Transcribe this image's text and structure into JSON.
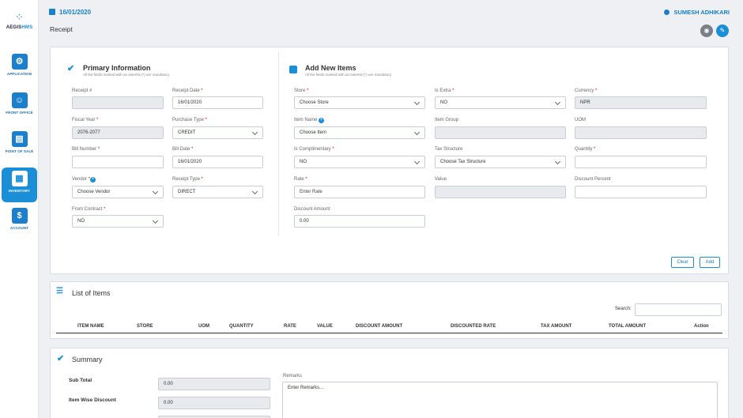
{
  "app": {
    "logo_text_a": "AEGIS",
    "logo_text_b": "HMS"
  },
  "sidebar": {
    "items": [
      {
        "label": "APPLICATION",
        "icon": "gear-monitor-icon"
      },
      {
        "label": "FRONT OFFICE",
        "icon": "reception-icon"
      },
      {
        "label": "POINT OF SALE",
        "icon": "pos-icon"
      },
      {
        "label": "INVENTORY",
        "icon": "inventory-icon",
        "active": true
      },
      {
        "label": "ACCOUNT",
        "icon": "dollar-icon"
      }
    ]
  },
  "header": {
    "date": "16/01/2020",
    "user": "SUMESH ADHIKARI",
    "page_title": "Receipt"
  },
  "primary": {
    "title": "Primary Information",
    "subtitle": "All the fields marked with an asterisk (*) are mandatory.",
    "receipt_no_label": "Receipt #",
    "receipt_no": "",
    "receipt_date_label": "Receipt Date",
    "receipt_date": "16/01/2020",
    "fiscal_year_label": "Fiscal Year",
    "fiscal_year": "2076-2077",
    "purchase_type_label": "Purchase Type",
    "purchase_type": "CREDIT",
    "bill_number_label": "Bill Number",
    "bill_number": "",
    "bill_date_label": "Bill Date",
    "bill_date": "16/01/2020",
    "vendor_label": "Vendor",
    "vendor": "Choose Vendor",
    "receipt_type_label": "Receipt Type",
    "receipt_type": "DIRECT",
    "from_contract_label": "From Contract",
    "from_contract": "NO"
  },
  "new_items": {
    "title": "Add New Items",
    "subtitle": "All the fields marked with an asterisk (*) are mandatory.",
    "store_label": "Store",
    "store": "Choose Store",
    "is_extra_label": "Is Extra",
    "is_extra": "NO",
    "currency_label": "Currency",
    "currency": "NPR",
    "item_name_label": "Item Name",
    "item_name": "Choose Item",
    "item_group_label": "Item Group",
    "item_group": "",
    "uom_label": "UOM",
    "uom": "",
    "is_complimentary_label": "Is Complimentary",
    "is_complimentary": "NO",
    "tax_structure_label": "Tax Structure",
    "tax_structure": "Choose Tax Structure",
    "quantity_label": "Quantity",
    "quantity": "",
    "rate_label": "Rate",
    "rate_placeholder": "Enter Rate",
    "value_label": "Value",
    "value": "",
    "discount_percent_label": "Discount Percent",
    "discount_percent": "",
    "discount_amount_label": "Discount Amount",
    "discount_amount": "0.00",
    "clear_label": "Clear",
    "add_label": "Add"
  },
  "list": {
    "title": "List of Items",
    "search_label": "Search:",
    "columns": [
      "ITEM NAME",
      "STORE",
      "UOM",
      "QUANTITY",
      "RATE",
      "VALUE",
      "DISCOUNT AMOUNT",
      "DISCOUNTED RATE",
      "TAX AMOUNT",
      "TOTAL AMOUNT",
      "Action"
    ]
  },
  "summary": {
    "title": "Summary",
    "sub_total_label": "Sub Total",
    "sub_total": "0.00",
    "item_wise_discount_label": "Item Wise Discount",
    "item_wise_discount": "0.00",
    "remarks_label": "Remarks",
    "remarks_placeholder": "Enter Remarks..."
  }
}
